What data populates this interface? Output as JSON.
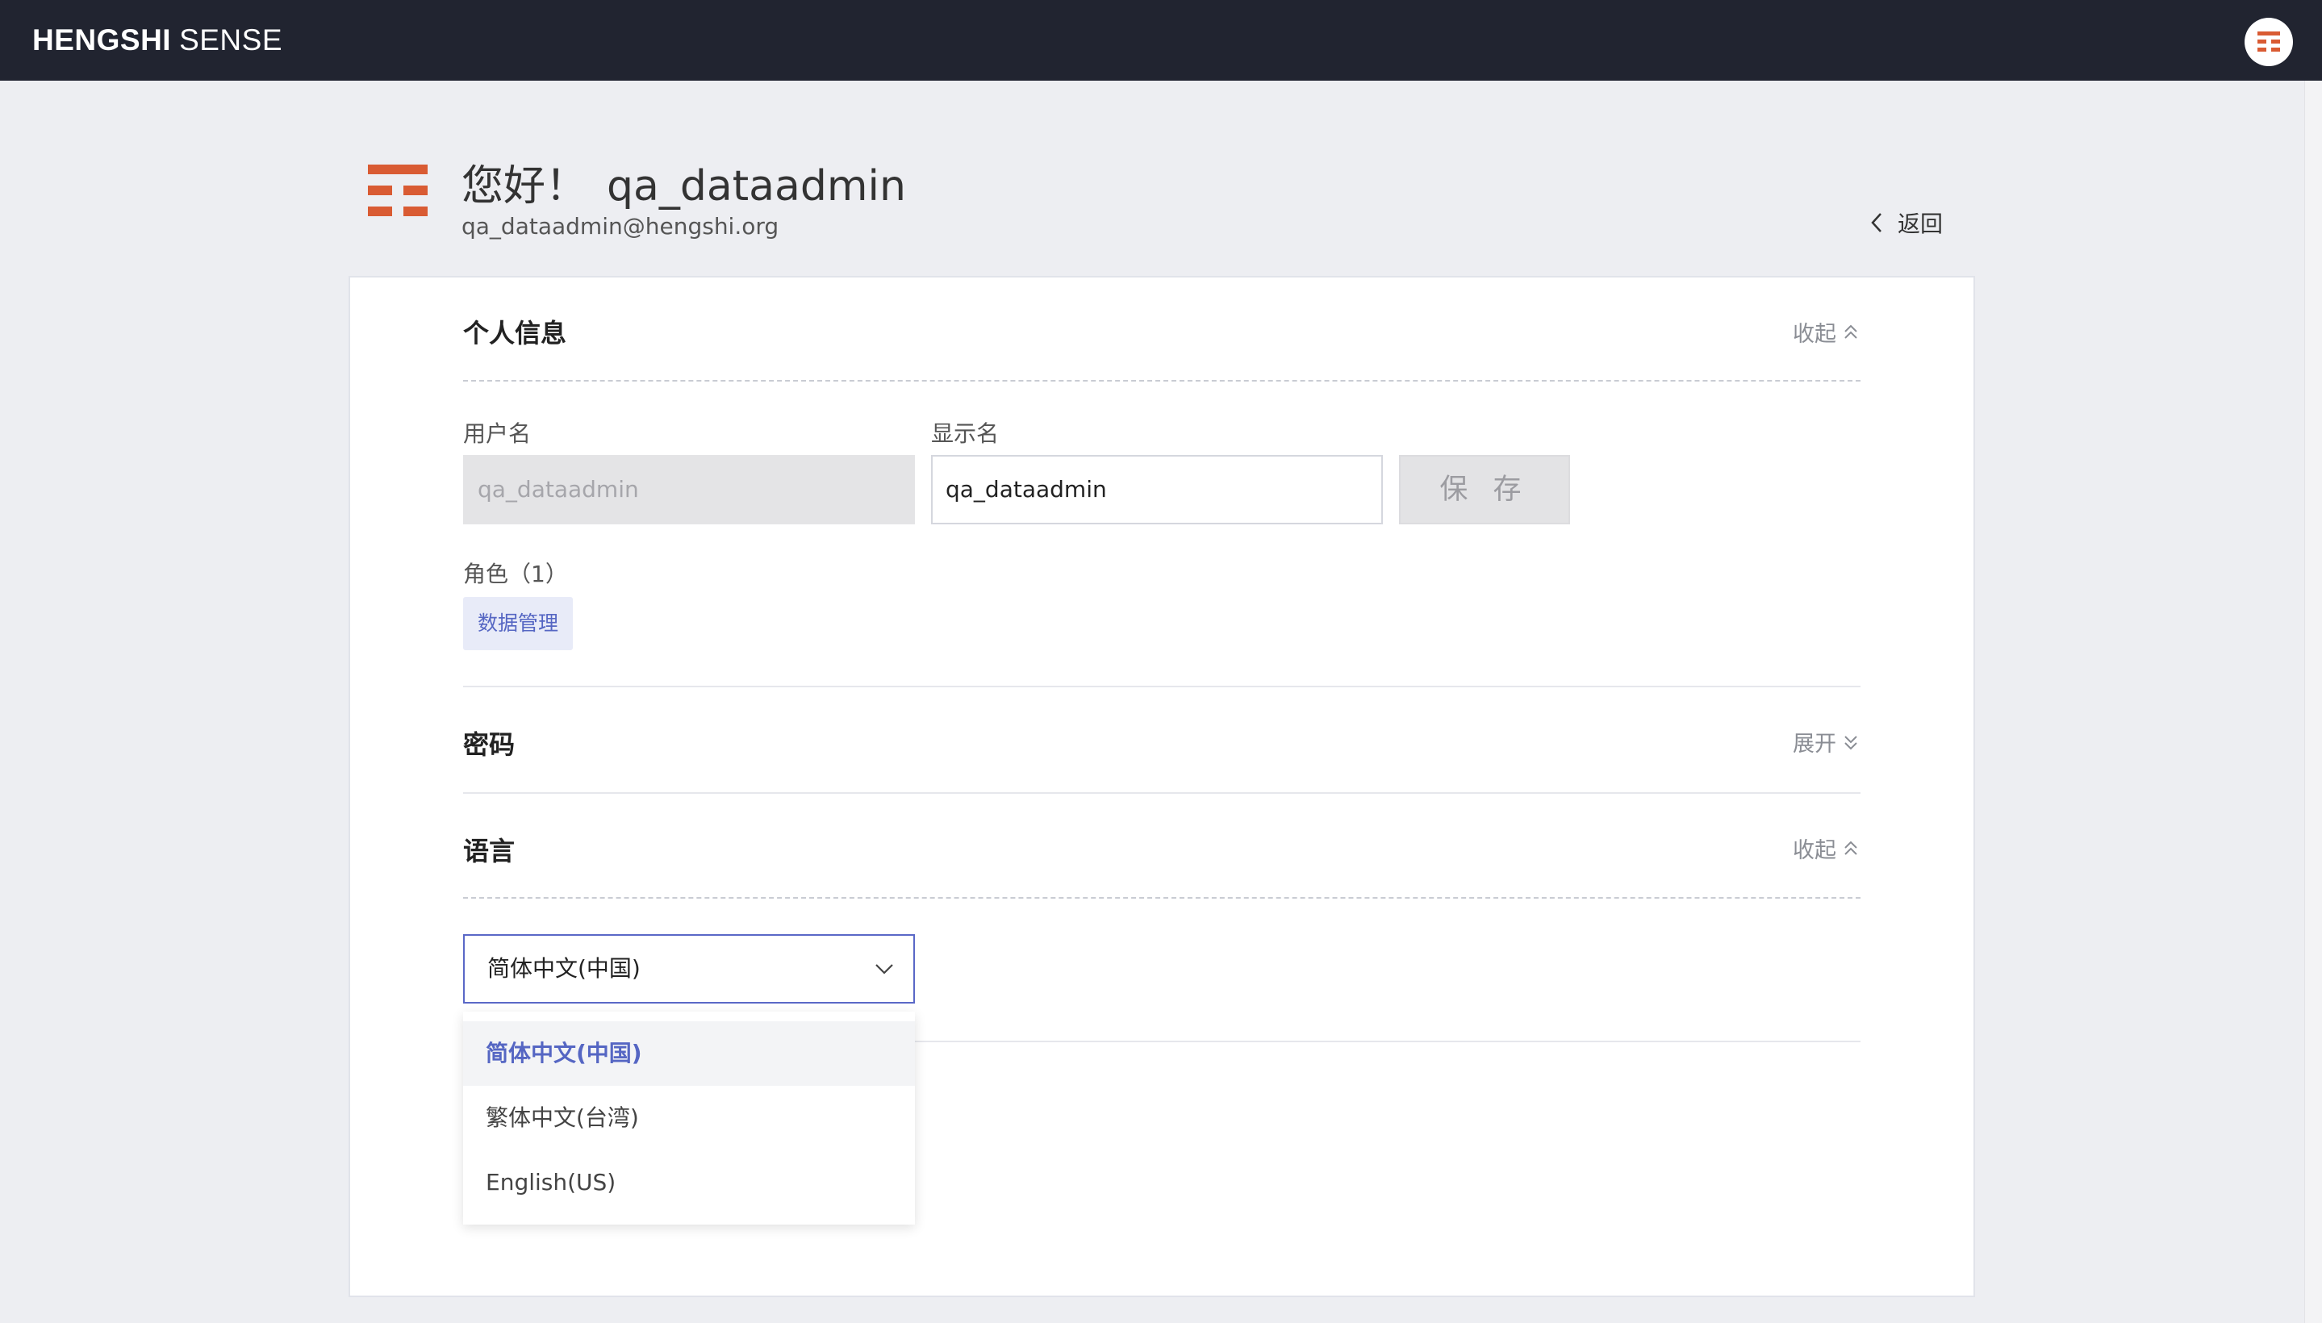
{
  "header": {
    "brand_bold": "HENGSHI",
    "brand_light": "SENSE",
    "avatar_icon": "hengshi-logo-icon"
  },
  "profile": {
    "greeting": "您好！",
    "username": "qa_dataadmin",
    "email": "qa_dataadmin@hengshi.org",
    "back_label": "返回"
  },
  "personal_info": {
    "title": "个人信息",
    "toggle_label": "收起",
    "username_label": "用户名",
    "username_value": "qa_dataadmin",
    "display_name_label": "显示名",
    "display_name_value": "qa_dataadmin",
    "save_label": "保 存",
    "roles_label": "角色（1）",
    "roles": [
      "数据管理"
    ]
  },
  "password": {
    "title": "密码",
    "toggle_label": "展开"
  },
  "language": {
    "title": "语言",
    "toggle_label": "收起",
    "selected": "简体中文(中国)",
    "options": [
      "简体中文(中国)",
      "繁体中文(台湾)",
      "English(US)"
    ]
  },
  "colors": {
    "topbar": "#212430",
    "accent": "#5566c3",
    "logo": "#d95b33",
    "background": "#edeef2"
  }
}
